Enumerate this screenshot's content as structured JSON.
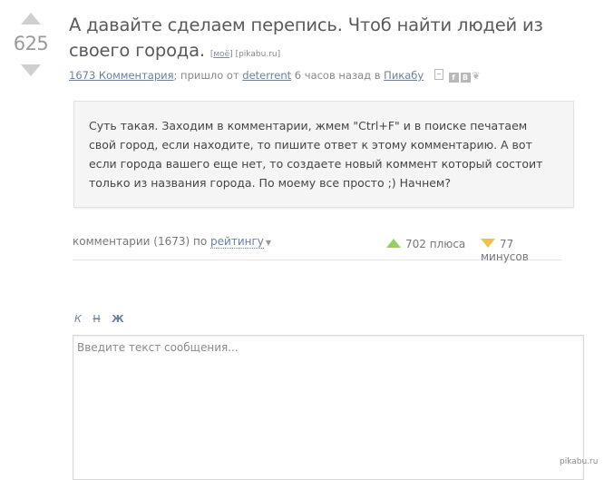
{
  "post": {
    "score": "625",
    "title": "А давайте сделаем перепись. Чтоб найти людей из своего города.",
    "tag_mine": "моё",
    "tag_source": "pikabu.ru",
    "comments_link": "1673 Комментария",
    "came_from": "; пришло от",
    "author": "deterrent",
    "time_text": "6 часов назад в",
    "community": "Пикабу",
    "social": {
      "fb": "f",
      "vk": "B",
      "tw": "❦"
    },
    "body": "Суть такая. Заходим в комментарии, жмем \"Ctrl+F\" и в поиске печатаем свой город, если находите, то пишите ответ к этому комментарию. А вот если города вашего еще нет, то создаете новый коммент который состоит только из названия города. По моему все просто ;) Начнем?"
  },
  "comments_bar": {
    "label": "комментарии (1673) по",
    "sort": "рейтингу",
    "pluses": "702 плюса",
    "minuses": "77 минусов"
  },
  "editor": {
    "italic": "К",
    "strike": "Н",
    "bold": "Ж",
    "placeholder": "Введите текст сообщения..."
  },
  "watermark": "pikabu.ru",
  "colors": {
    "plus": "#9ccc65",
    "minus": "#f0c24a",
    "link": "#6b7f9e"
  }
}
